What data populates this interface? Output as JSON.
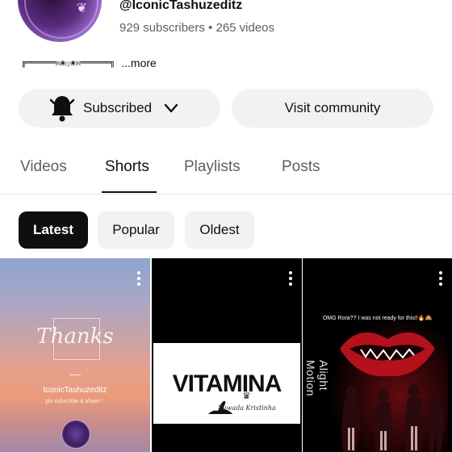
{
  "channel": {
    "handle": "@IconicTashuzeditz",
    "stats": "929 subscribers • 265 videos",
    "description_art": "╔══════೫❀۞❀೫══════╗",
    "more_label": "...more"
  },
  "actions": {
    "subscribe_label": "Subscribed",
    "community_label": "Visit community"
  },
  "tabs": [
    {
      "label": "Videos",
      "active": false
    },
    {
      "label": "Shorts",
      "active": true
    },
    {
      "label": "Playlists",
      "active": false
    },
    {
      "label": "Posts",
      "active": false
    }
  ],
  "filters": [
    {
      "label": "Latest",
      "active": true
    },
    {
      "label": "Popular",
      "active": false
    },
    {
      "label": "Oldest",
      "active": false
    }
  ],
  "shorts": [
    {
      "overlay_title": "Thanks",
      "overlay_name": "IconicTashuzeditz",
      "overlay_sub": "pls subscribe & share♡"
    },
    {
      "overlay_title": "VITAMINA",
      "overlay_sub": "Tuwada Kristinha"
    },
    {
      "overlay_caption": "OMG Rora?? I was not ready for this!!🔥🙈",
      "overlay_side": "Alight Motion"
    }
  ],
  "colors": {
    "text_primary": "#0f0f0f",
    "text_secondary": "#606060",
    "chip_bg": "#f2f2f2",
    "chip_active_bg": "#0f0f0f"
  }
}
